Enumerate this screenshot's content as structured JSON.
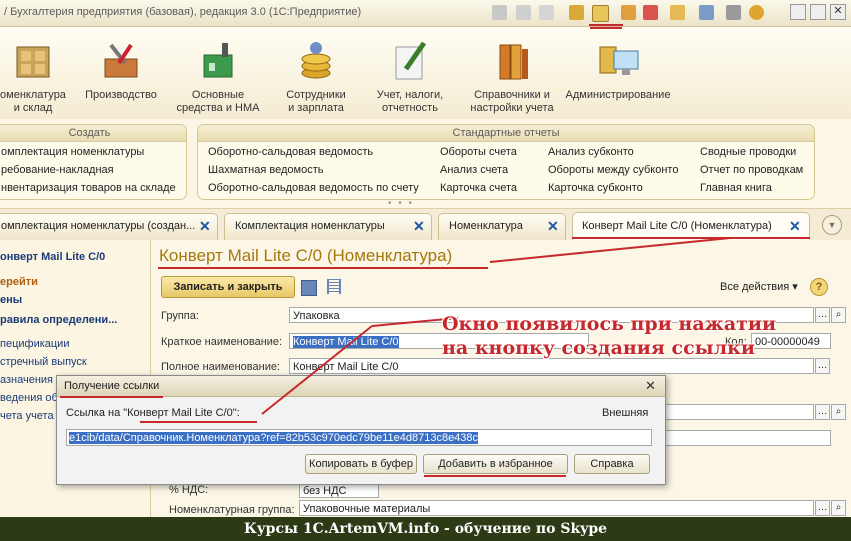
{
  "window": {
    "title": "/ Бухгалтерия предприятия (базовая), редакция 3.0  (1С:Предприятие)"
  },
  "sections": [
    {
      "label": "оменклатура\nи склад",
      "icon": "warehouse-icon"
    },
    {
      "label": "Производство",
      "icon": "tools-box-icon"
    },
    {
      "label": "Основные\nсредства и НМА",
      "icon": "factory-icon"
    },
    {
      "label": "Сотрудники\nи зарплата",
      "icon": "coins-icon"
    },
    {
      "label": "Учет, налоги,\nотчетность",
      "icon": "pen-icon"
    },
    {
      "label": "Справочники и\nнастройки учета",
      "icon": "books-icon"
    },
    {
      "label": "Администрирование",
      "icon": "admin-computer-icon"
    }
  ],
  "create_panel": {
    "title": "Создать",
    "items": [
      "омплектация номенклатуры",
      "ребование-накладная",
      "нвентаризация товаров на складе"
    ]
  },
  "reports_panel": {
    "title": "Стандартные отчеты",
    "col1": [
      "Оборотно-сальдовая ведомость",
      "Шахматная ведомость",
      "Оборотно-сальдовая ведомость по счету"
    ],
    "col2": [
      "Обороты счета",
      "Анализ счета",
      "Карточка счета"
    ],
    "col3": [
      "Анализ субконто",
      "Обороты между субконто",
      "Карточка субконто"
    ],
    "col4": [
      "Сводные проводки",
      "Отчет по проводкам",
      "Главная книга"
    ]
  },
  "tabs": [
    "омплектация номенклатуры (создан...",
    "Комплектация номенклатуры",
    "Номенклатура",
    "Конверт Mail Lite C/0 (Номенклатура)"
  ],
  "leftnav": {
    "title": "онверт Mail Lite C/0",
    "goto": "ерейти",
    "items_bold": [
      "ены",
      "равила определени..."
    ],
    "items": [
      "пецификации",
      "стречный выпуск",
      "азначения",
      "ведения об",
      "чета учета"
    ]
  },
  "form": {
    "header": "Конверт Mail Lite C/0 (Номенклатура)",
    "save_close": "Записать и закрыть",
    "all_actions": "Все действия ▾",
    "help": "?",
    "group_label": "Группа:",
    "group_value": "Упаковка",
    "short_label": "Краткое наименование:",
    "short_value": "Конверт Mail Lite C/0",
    "code_label": "Код:",
    "code_value": "00-00000049",
    "full_label": "Полное наименование:",
    "full_value": "Конверт Mail Lite C/0",
    "vat_label": "% НДС:",
    "vat_value": "без НДС",
    "nomgroup_label": "Номенклатурная группа:",
    "nomgroup_value": "Упаковочные материалы"
  },
  "dialog": {
    "title": "Получение ссылки",
    "link_label": "Ссылка на \"Конверт Mail Lite C/0\":",
    "external": "Внешняя",
    "link_value": "e1cib/data/Справочник.Номенклатура?ref=82b53c970edc79be11e4d8713c8e438c",
    "copy_button": "Копировать в буфер",
    "fav_button": "Добавить в избранное",
    "help_button": "Справка"
  },
  "annotation": "Окно появилось при нажатии\nна кнопку создания ссылки",
  "banner": "Курсы 1С.ArtemVM.info - обучение по Skype",
  "colors": {
    "accent_red": "#c6282c",
    "header_gold": "#a5790f",
    "banner_bg": "#2c3a16",
    "link_blue": "#1b56a8"
  }
}
